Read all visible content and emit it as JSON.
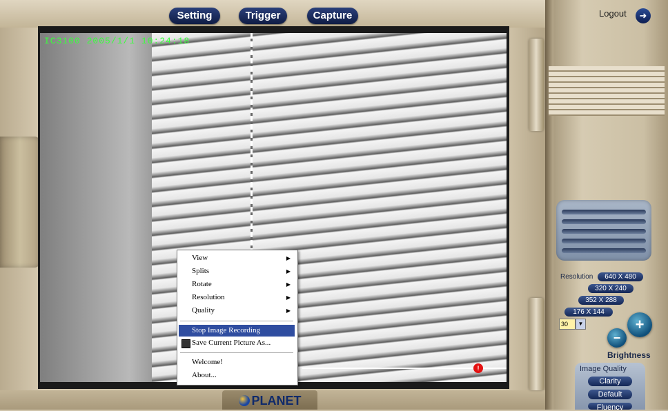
{
  "toolbar": {
    "setting_label": "Setting",
    "trigger_label": "Trigger",
    "capture_label": "Capture"
  },
  "header": {
    "logout_label": "Logout"
  },
  "video": {
    "overlay_text": "IC3100  2005/1/1  10:24:18"
  },
  "brand": {
    "logo_text": "PLANET"
  },
  "context_menu": {
    "items": [
      {
        "label": "View",
        "submenu": true
      },
      {
        "label": "Splits",
        "submenu": true
      },
      {
        "label": "Rotate",
        "submenu": true
      },
      {
        "label": "Resolution",
        "submenu": true
      },
      {
        "label": "Quality",
        "submenu": true
      },
      {
        "label": "Stop Image Recording",
        "selected": true
      },
      {
        "label": "Save Current Picture As..."
      },
      {
        "label": "Welcome!"
      },
      {
        "label": "About..."
      }
    ]
  },
  "controls": {
    "resolution_label": "Resolution",
    "resolutions": [
      "640 X 480",
      "320 X 240",
      "352 X 288",
      "176 X 144"
    ],
    "fps_value": "30",
    "brightness_label": "Brightness",
    "brightness_minus": "−",
    "brightness_plus": "+",
    "image_quality_label": "Image Quality",
    "quality_options": [
      "Clarity",
      "Default",
      "Fluency"
    ]
  },
  "colors": {
    "accent": "#142756",
    "overlay_text": "#39ff3c",
    "menu_selected": "#2f4da0",
    "record_indicator": "#e41111"
  }
}
